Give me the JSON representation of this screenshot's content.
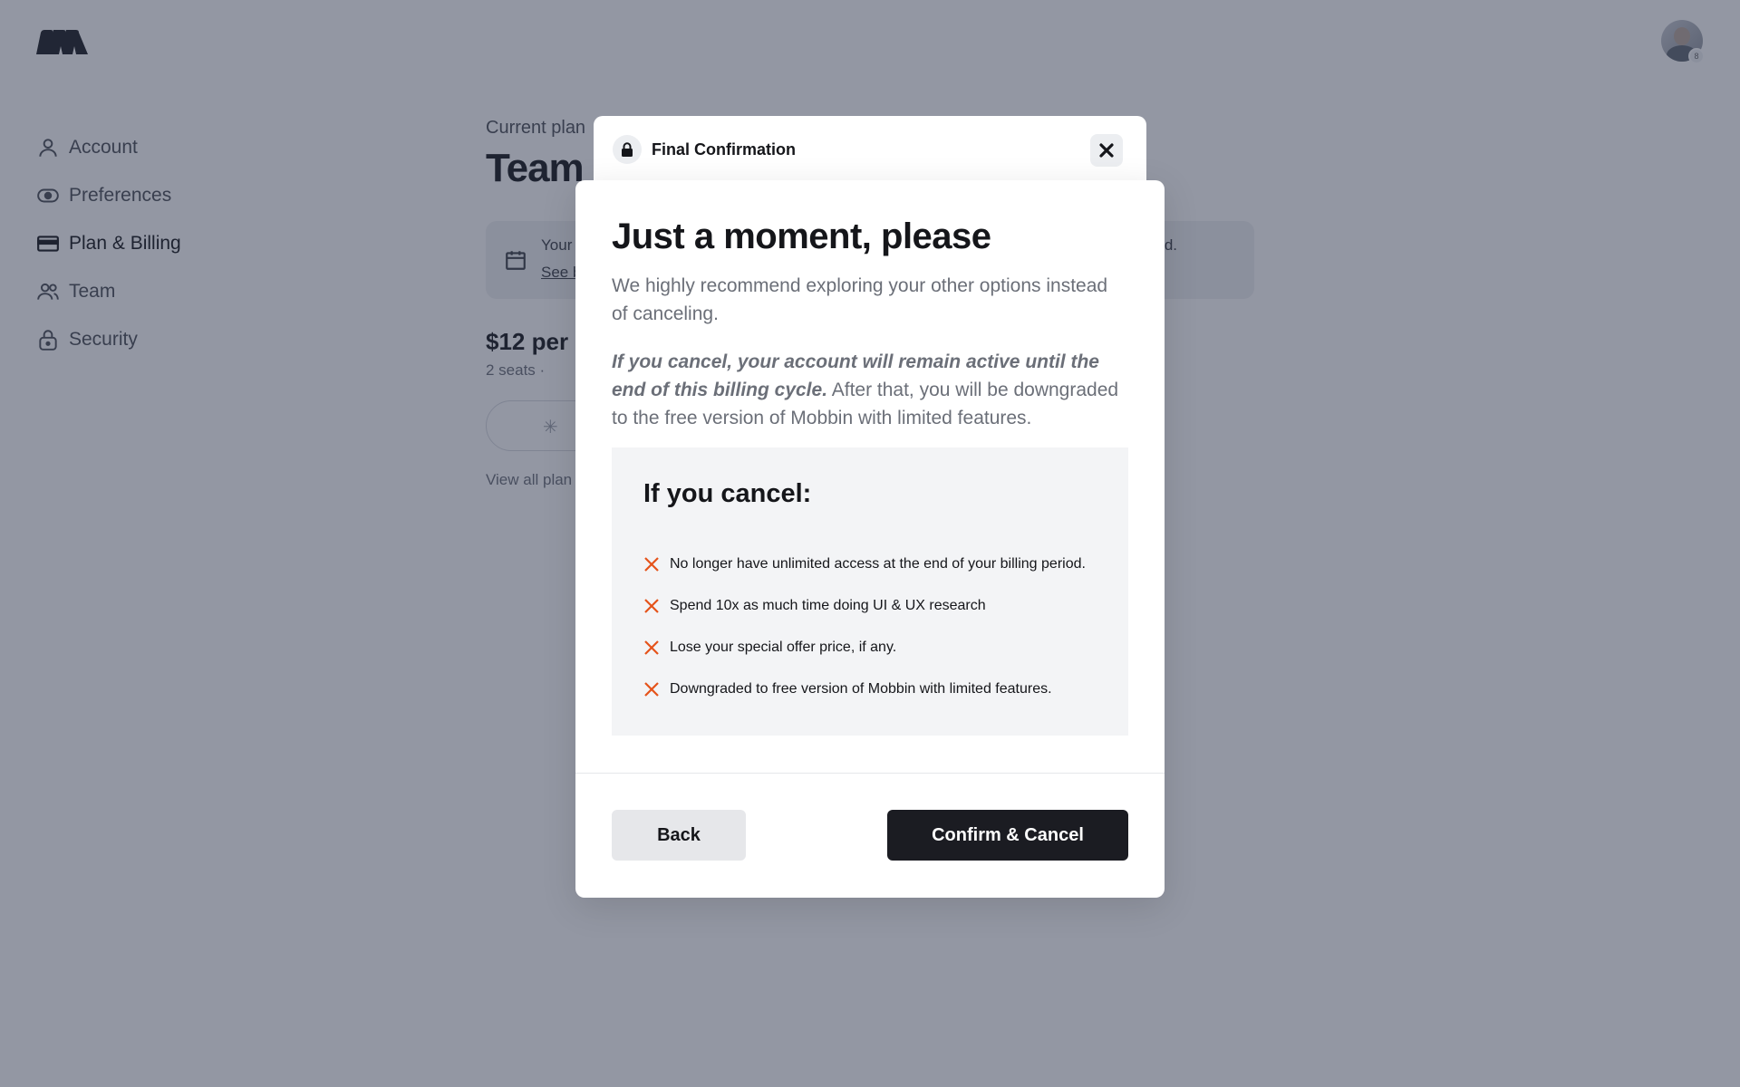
{
  "app": {
    "avatar_badge": "8",
    "sidebar": {
      "items": [
        {
          "label": "Account",
          "icon": "person-icon"
        },
        {
          "label": "Preferences",
          "icon": "toggle-icon"
        },
        {
          "label": "Plan & Billing",
          "icon": "credit-card-icon",
          "active": true
        },
        {
          "label": "Team",
          "icon": "people-icon"
        },
        {
          "label": "Security",
          "icon": "lock-icon"
        }
      ]
    },
    "main": {
      "current_plan_label": "Current plan",
      "plan_name": "Team",
      "notice_line1": "Your",
      "notice_link": "See b",
      "notice_end": "d.",
      "price": "$12 per m",
      "seats": "2 seats ·",
      "view_all_plans": "View all plan"
    }
  },
  "modal": {
    "tab_title": "Final Confirmation",
    "heading": "Just a moment, please",
    "intro": "We highly recommend exploring your other options instead of canceling.",
    "warning_emphasis": "If you cancel, your account will remain active until the end of this billing cycle.",
    "warning_rest": " After that, you will be downgraded to the free version of Mobbin with limited features.",
    "cancel_box": {
      "title": "If you cancel:",
      "items": [
        "No longer have unlimited access at the end of your billing period.",
        "Spend 10x as much time doing UI & UX research",
        "Lose your special offer price, if any.",
        "Downgraded to free version of Mobbin with limited features."
      ]
    },
    "back_label": "Back",
    "confirm_label": "Confirm & Cancel"
  },
  "colors": {
    "overlay": "#272f47",
    "x_mark": "#e5531a",
    "confirm_bg": "#1b1c22",
    "back_bg": "#e6e7ea"
  }
}
